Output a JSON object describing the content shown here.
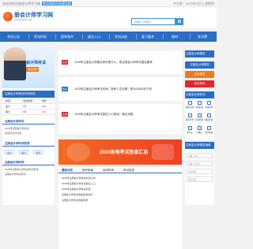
{
  "topbar": {
    "welcome": "欢迎访问注册会计师学习网",
    "tag": "考试网首页快速导航",
    "right": "今天是：2025年8月日 星期四"
  },
  "header": {
    "logo_title": "册会计师学习网",
    "logo_url": "www.kjwh51.com",
    "search_placeholder": "请输入关键词"
  },
  "nav": [
    "考试公告",
    "考试时间",
    "报考条件",
    "报名入口",
    "考试动态",
    "复习备考",
    "教材",
    "考试费"
  ],
  "banner": {
    "text": "会计师考试",
    "badge": "考前冲刺"
  },
  "left": {
    "bar": "注册会计师考试时间安排",
    "table": [
      [
        "科目",
        "考试时间",
        "时长"
      ],
      [
        "会计",
        "8月",
        "180"
      ],
      [
        "审计",
        "8月",
        "150"
      ]
    ],
    "section1": "注册会计师考试",
    "lines": [
      "2025年注册会计师考试",
      "考试科目与时间"
    ],
    "section2": "注册会计师时间安排",
    "pills": [
      "会计",
      "审计",
      "财管"
    ],
    "section3": "注册会计师时间",
    "lines2": [
      "2025年注册会计师考试时间安排",
      "注册会计师考试时间"
    ]
  },
  "center": {
    "news": [
      {
        "tag": "头条",
        "title": "2025年注册会计师报名条件是什么，附注册会计师考试报名要求"
      },
      {
        "tag": "热点",
        "title": "2025年注册会计师考试时间，报考人员必看！附2025年6月下旬"
      },
      {
        "tag": "头条",
        "title": "2025年注册会计师考试报名入口官网，报名流程"
      }
    ],
    "promo": "2024各地考试信息汇总",
    "tabs": [
      "最新动态",
      "报考指南",
      "培训机构",
      "考试信息"
    ],
    "list": [
      "2025年注册会计师考试时间公布",
      "2025年注册会计师考试报名入口",
      "2025年注册会计师考试科目",
      "注册会计师考试成绩查询时间",
      "注册会计师考试合格标准"
    ]
  },
  "right": {
    "title1": "注册会计师报名",
    "btn_blue": "注册会计师报名",
    "btn_orange": "点击报名",
    "btn_red": "考试资讯",
    "title2": "注册会计师考试",
    "grid": [
      "报名时间",
      "考试科目",
      "考试时间",
      "报考条件",
      "考试费用",
      "成绩查询",
      "准考证",
      "合格证",
      "考试动态"
    ],
    "title3": "注册会计师报名指南",
    "inputs": [
      "请输入姓名",
      "请输入手机号",
      "所在地区",
      "报考科目"
    ]
  },
  "colors": {
    "brand": "#2a6dc4",
    "accent": "#f07a1b",
    "red": "#e0272e"
  }
}
